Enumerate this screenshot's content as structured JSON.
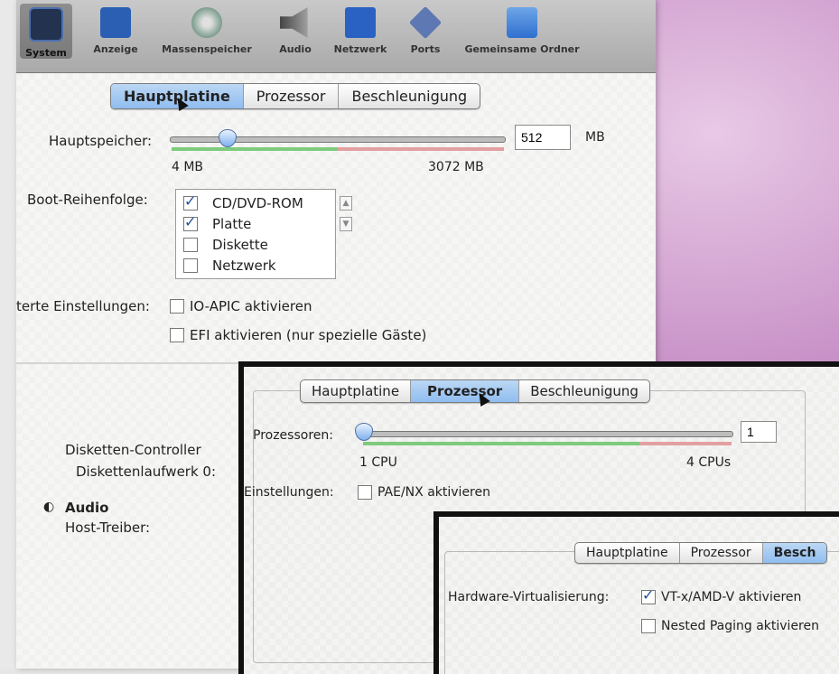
{
  "toolbar": {
    "items": [
      {
        "label": "System",
        "icon": "system-icon"
      },
      {
        "label": "Anzeige",
        "icon": "display-icon"
      },
      {
        "label": "Massenspeicher",
        "icon": "storage-icon"
      },
      {
        "label": "Audio",
        "icon": "audio-icon"
      },
      {
        "label": "Netzwerk",
        "icon": "network-icon"
      },
      {
        "label": "Ports",
        "icon": "ports-icon"
      },
      {
        "label": "Gemeinsame Ordner",
        "icon": "shared-folder-icon"
      }
    ],
    "selected": "System"
  },
  "main_tabs": [
    "Hauptplatine",
    "Prozessor",
    "Beschleunigung"
  ],
  "motherboard": {
    "memory_label": "Hauptspeicher:",
    "memory_value": "512",
    "memory_unit": "MB",
    "memory_min": "4 MB",
    "memory_max": "3072 MB",
    "memory_fraction": 0.167,
    "boot_label": "Boot-Reihenfolge:",
    "boot_items": [
      {
        "label": "CD/DVD-ROM",
        "checked": true
      },
      {
        "label": "Platte",
        "checked": true
      },
      {
        "label": "Diskette",
        "checked": false
      },
      {
        "label": "Netzwerk",
        "checked": false
      }
    ],
    "extended_label": "terte Einstellungen:",
    "ioapic_label": "IO-APIC aktivieren",
    "efi_label": "EFI aktivieren (nur spezielle Gäste)"
  },
  "details_peek": {
    "floppy_controller": "Disketten-Controller",
    "floppy_drive": "Diskettenlaufwerk 0:",
    "audio_heading": "Audio",
    "host_driver": "Host-Treiber:"
  },
  "processor": {
    "tabs": [
      "Hauptplatine",
      "Prozessor",
      "Beschleunigung"
    ],
    "cpus_label": "Prozessoren:",
    "cpus_value": "1",
    "cpus_min": "1 CPU",
    "cpus_max": "4 CPUs",
    "cpus_fraction": 0.0,
    "extended_label": "Einstellungen:",
    "pae_label": "PAE/NX aktivieren"
  },
  "acceleration": {
    "tabs": [
      "Hauptplatine",
      "Prozessor",
      "Besch"
    ],
    "hw_label": "Hardware-Virtualisierung:",
    "vtx_label": "VT-x/AMD-V aktivieren",
    "nested_label": "Nested Paging aktivieren"
  },
  "colors": {
    "accent_tab": "#8fbdf0",
    "check": "#1d4f9e",
    "range_green": "#7ecb7e",
    "range_red": "#e3a0a0"
  }
}
